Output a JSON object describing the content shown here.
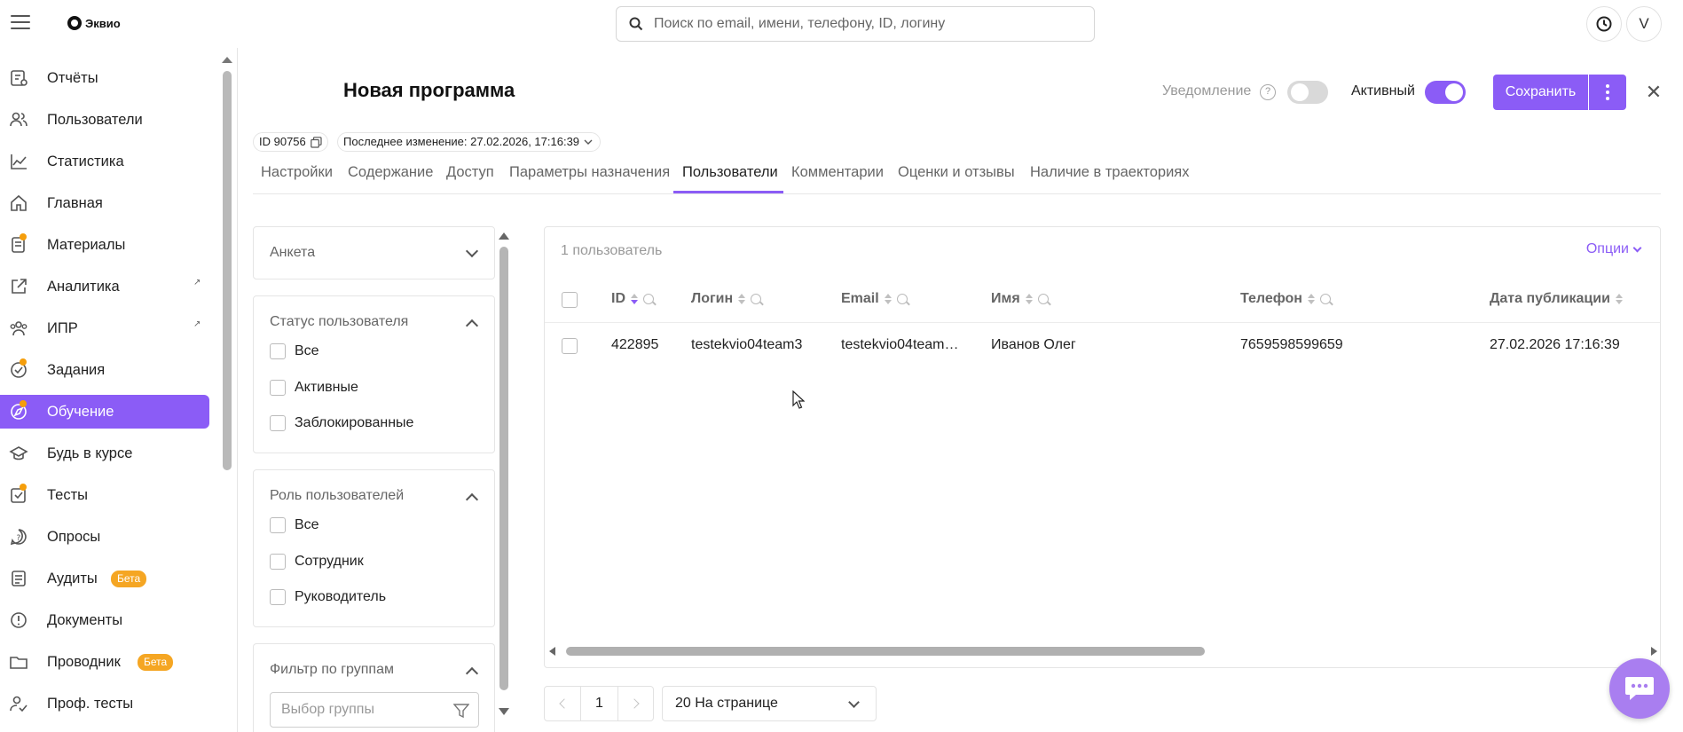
{
  "app": {
    "brand": "Эквио"
  },
  "search": {
    "placeholder": "Поиск по email, имени, телефону, ID, логину"
  },
  "header": {
    "avatar_letter": "V"
  },
  "sidebar": {
    "items": [
      {
        "label": "Отчёты",
        "icon": "report-icon"
      },
      {
        "label": "Пользователи",
        "icon": "users-icon"
      },
      {
        "label": "Статистика",
        "icon": "chart-icon"
      },
      {
        "label": "Главная",
        "icon": "home-icon"
      },
      {
        "label": "Материалы",
        "icon": "materials-icon"
      },
      {
        "label": "Аналитика",
        "icon": "external-link-icon"
      },
      {
        "label": "ИПР",
        "icon": "people-icon"
      },
      {
        "label": "Задания",
        "icon": "tasks-icon"
      },
      {
        "label": "Обучение",
        "icon": "learning-icon"
      },
      {
        "label": "Будь в курсе",
        "icon": "graduation-icon"
      },
      {
        "label": "Тесты",
        "icon": "tests-icon"
      },
      {
        "label": "Опросы",
        "icon": "survey-icon"
      },
      {
        "label": "Аудиты",
        "icon": "audit-icon",
        "badge": "Бета"
      },
      {
        "label": "Документы",
        "icon": "document-icon"
      },
      {
        "label": "Проводник",
        "icon": "folder-icon",
        "badge": "Бета"
      },
      {
        "label": "Проф. тесты",
        "icon": "prof-tests-icon"
      }
    ],
    "ext_arrow": "↗"
  },
  "page": {
    "title": "Новая программа",
    "notification_label": "Уведомление",
    "help_glyph": "?",
    "active_label": "Активный",
    "save_label": "Сохранить",
    "close_glyph": "✕",
    "id_label": "ID 90756",
    "last_change": "Последнее изменение: 27.02.2026, 17:16:39"
  },
  "tabs": [
    {
      "label": "Настройки"
    },
    {
      "label": "Содержание"
    },
    {
      "label": "Доступ"
    },
    {
      "label": "Параметры назначения"
    },
    {
      "label": "Пользователи",
      "active": true
    },
    {
      "label": "Комментарии"
    },
    {
      "label": "Оценки и отзывы"
    },
    {
      "label": "Наличие в траекториях"
    }
  ],
  "filters": {
    "survey": {
      "title": "Анкета"
    },
    "user_status": {
      "title": "Статус пользователя",
      "options": [
        "Все",
        "Активные",
        "Заблокированные"
      ]
    },
    "user_role": {
      "title": "Роль пользователей",
      "options": [
        "Все",
        "Сотрудник",
        "Руководитель"
      ]
    },
    "groups": {
      "title": "Фильтр по группам",
      "placeholder": "Выбор группы"
    }
  },
  "table": {
    "count": "1 пользователь",
    "options_label": "Опции",
    "columns": [
      "ID",
      "Логин",
      "Email",
      "Имя",
      "Телефон",
      "Дата публикации"
    ],
    "rows": [
      [
        "422895",
        "testekvio04team3",
        "testekvio04team…",
        "Иванов Олег",
        "7659598599659",
        "27.02.2026 17:16:39"
      ]
    ]
  },
  "pagination": {
    "page": "1",
    "per_page": "20 На странице"
  },
  "colors": {
    "accent": "#8b5cf6",
    "beta_badge": "#f5a623"
  }
}
